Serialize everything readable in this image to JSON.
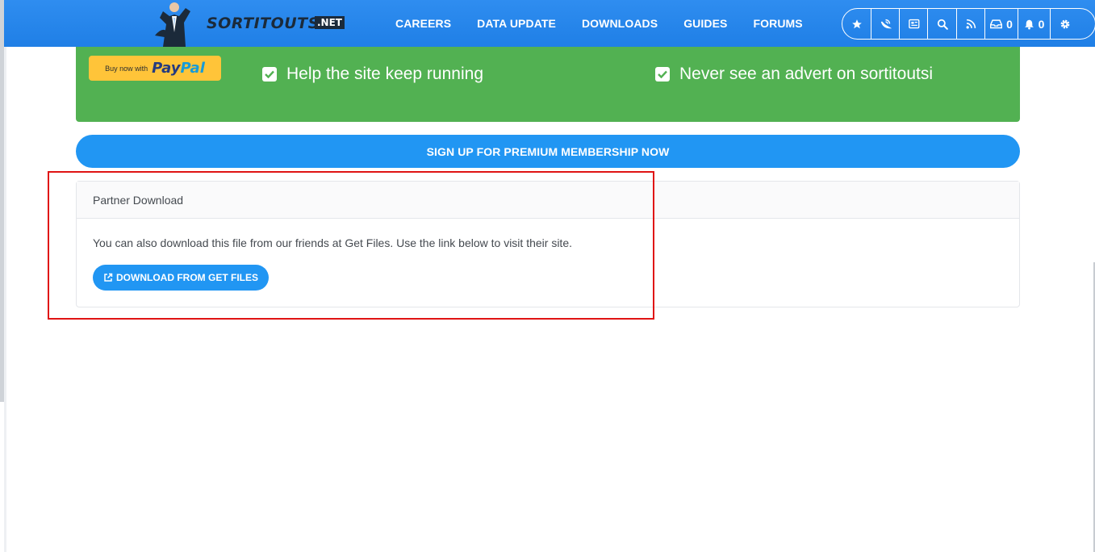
{
  "navbar": {
    "logo_text": "SORTITOUTSI",
    "logo_suffix": ".NET",
    "links": [
      "CAREERS",
      "DATA UPDATE",
      "DOWNLOADS",
      "GUIDES",
      "FORUMS"
    ],
    "icons": [
      {
        "name": "star-icon"
      },
      {
        "name": "satellite-icon"
      },
      {
        "name": "newspaper-icon"
      },
      {
        "name": "search-icon"
      },
      {
        "name": "rss-icon"
      },
      {
        "name": "inbox-icon",
        "count": "0"
      },
      {
        "name": "bell-icon",
        "count": "0"
      },
      {
        "name": "gear-icon"
      }
    ]
  },
  "premium": {
    "paypal_small": "Buy now with",
    "paypal_pay": "Pay",
    "paypal_pal": "Pal",
    "benefit_left": "Help the site keep running",
    "benefit_right": "Never see an advert on sortitoutsi",
    "bg_color": "#52b152"
  },
  "signup": {
    "label": "SIGN UP FOR PREMIUM MEMBERSHIP NOW"
  },
  "partner": {
    "title": "Partner Download",
    "text": "You can also download this file from our friends at Get Files. Use the link below to visit their site.",
    "button_label": "DOWNLOAD FROM GET FILES"
  },
  "colors": {
    "accent": "#2196f3",
    "navbar": "#1f7fe6",
    "highlight": "#e01414"
  }
}
